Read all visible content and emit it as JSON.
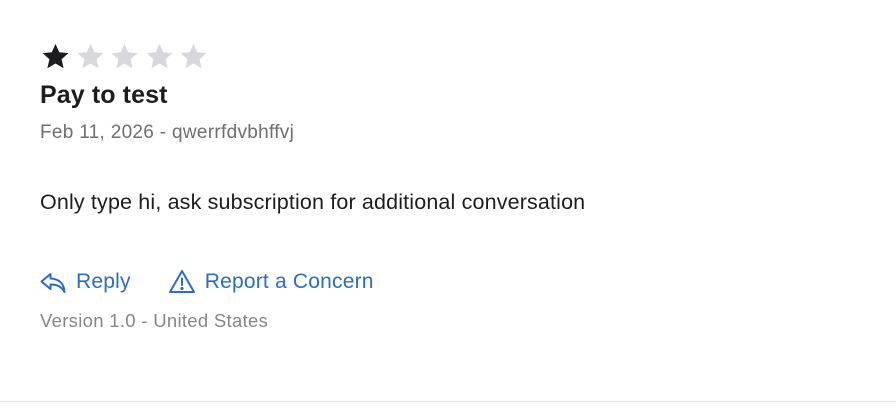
{
  "review": {
    "rating": 1,
    "max_rating": 5,
    "title": "Pay to test",
    "date": "Feb 11, 2026",
    "separator": "-",
    "author": "qwerrfdvbhffvj",
    "body": "Only type hi, ask subscription for additional conversation",
    "version_info": "Version 1.0 - United States"
  },
  "actions": {
    "reply_label": "Reply",
    "report_label": "Report a Concern",
    "reply_icon": "reply-arrow-icon",
    "report_icon": "warning-triangle-icon"
  },
  "colors": {
    "star_filled": "#1d1d1f",
    "star_empty": "#d8d8dc",
    "link": "#2b6dc4",
    "meta_text": "#6e6e73"
  }
}
